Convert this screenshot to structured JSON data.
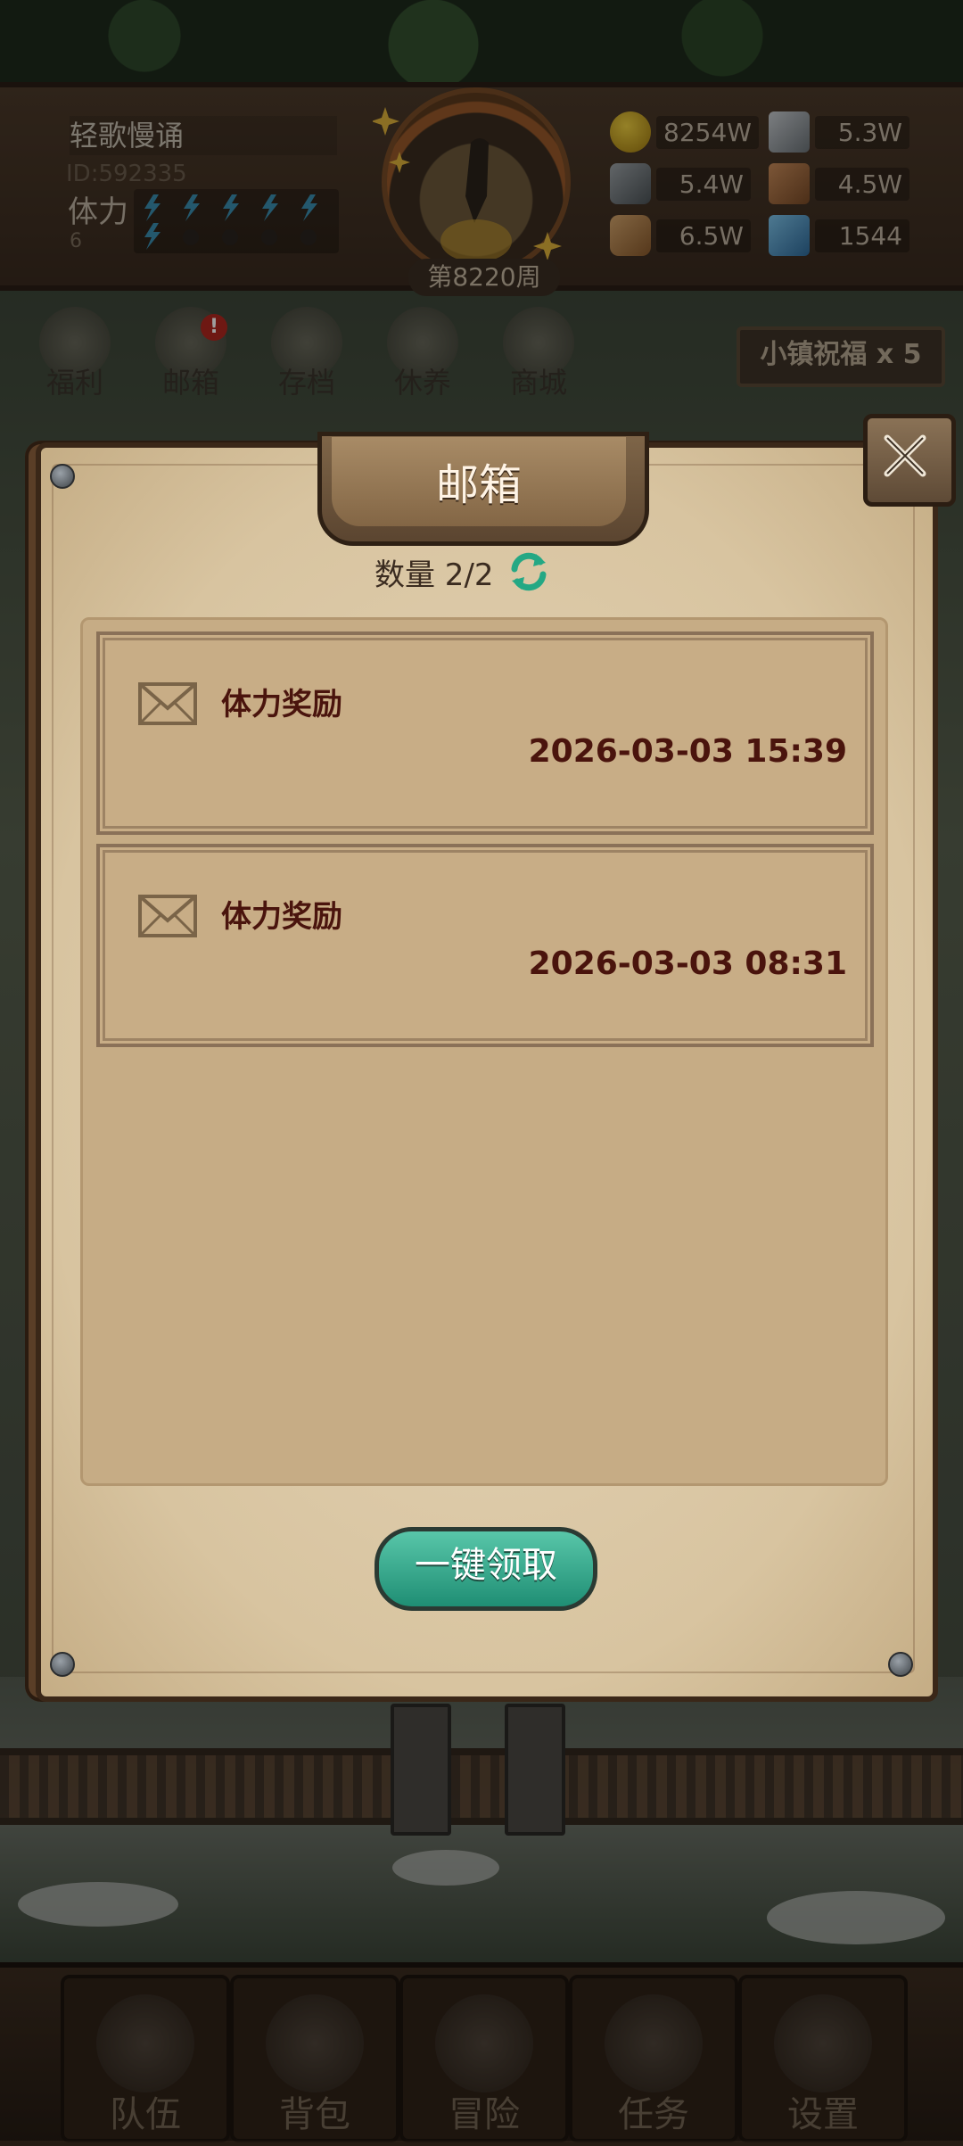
{
  "player": {
    "name": "轻歌慢诵",
    "id": "ID:592335",
    "stamina_label": "体力",
    "stamina_value": "6"
  },
  "week": "第8220周",
  "resources": [
    {
      "icon": "gold-coin-icon",
      "value": "8254W"
    },
    {
      "icon": "iron-ingot-icon",
      "value": "5.3W"
    },
    {
      "icon": "stone-icon",
      "value": "5.4W"
    },
    {
      "icon": "leather-icon",
      "value": "4.5W"
    },
    {
      "icon": "wood-log-icon",
      "value": "6.5W"
    },
    {
      "icon": "crystal-icon",
      "value": "1544"
    }
  ],
  "top_menu": [
    "福利",
    "邮箱",
    "存档",
    "休养",
    "商城"
  ],
  "mail_alert": "!",
  "blessing": "小镇祝福 x 5",
  "dialog": {
    "title": "邮箱",
    "count_text": "数量 2/2",
    "mails": [
      {
        "title": "体力奖励",
        "time": "2026-03-03 15:39"
      },
      {
        "title": "体力奖励",
        "time": "2026-03-03 08:31"
      }
    ],
    "claim_all": "一键领取"
  },
  "bottom_nav": [
    "队伍",
    "背包",
    "冒险",
    "任务",
    "设置"
  ],
  "colors": {
    "dialog_parchment": "#d8c4a0",
    "mail_text": "#4a140d",
    "claim_button": "#2fae8e"
  }
}
